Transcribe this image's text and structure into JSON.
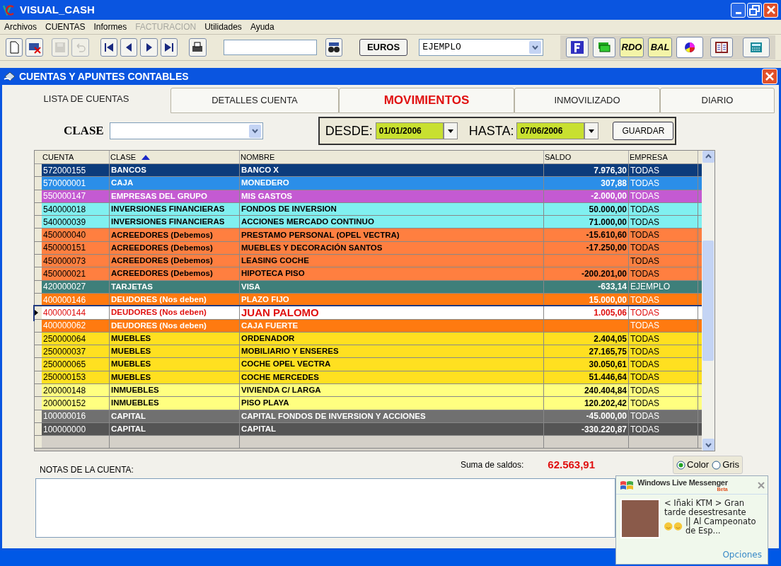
{
  "window": {
    "title": "VISUAL_CASH"
  },
  "menu": [
    {
      "label": "Archivos",
      "disabled": false
    },
    {
      "label": "CUENTAS",
      "disabled": false
    },
    {
      "label": "Informes",
      "disabled": false
    },
    {
      "label": "FACTURACION",
      "disabled": true
    },
    {
      "label": "Utilidades",
      "disabled": false
    },
    {
      "label": "Ayuda",
      "disabled": false
    }
  ],
  "toolbar": {
    "currency_button": "EUROS",
    "company_combo": "EJEMPLO",
    "report_buttons": [
      "RDO",
      "BAL"
    ]
  },
  "child_window": {
    "title": "CUENTAS Y APUNTES CONTABLES"
  },
  "tabs": [
    {
      "label": "LISTA DE CUENTAS",
      "selected": true,
      "highlight": false
    },
    {
      "label": "DETALLES CUENTA",
      "selected": false,
      "highlight": false
    },
    {
      "label": "MOVIMIENTOS",
      "selected": false,
      "highlight": true
    },
    {
      "label": "INMOVILIZADO",
      "selected": false,
      "highlight": false
    },
    {
      "label": "DIARIO",
      "selected": false,
      "highlight": false
    }
  ],
  "filter": {
    "clase_label": "CLASE",
    "desde_label": "DESDE:",
    "desde": "01/01/2006",
    "hasta_label": "HASTA:",
    "hasta": "07/06/2006",
    "save_button": "GUARDAR"
  },
  "table": {
    "columns": [
      "CUENTA",
      "CLASE",
      "NOMBRE",
      "SALDO",
      "EMPRESA"
    ],
    "rows": [
      {
        "cuenta": "572000155",
        "clase": "BANCOS",
        "nombre": "BANCO X",
        "saldo": "7.976,30",
        "empresa": "TODAS",
        "color": "#0c3c7c",
        "selected": false
      },
      {
        "cuenta": "570000001",
        "clase": "CAJA",
        "nombre": "MONEDERO",
        "saldo": "307,88",
        "empresa": "TODAS",
        "color": "#2b8ee8",
        "selected": false
      },
      {
        "cuenta": "550000147",
        "clase": "EMPRESAS DEL GRUPO",
        "nombre": "MIS GASTOS",
        "saldo": "-2.000,00",
        "empresa": "TODAS",
        "color": "#c45ad2",
        "selected": false
      },
      {
        "cuenta": "540000018",
        "clase": "INVERSIONES FINANCIERAS",
        "nombre": "FONDOS DE INVERSION",
        "saldo": "50.000,00",
        "empresa": "TODAS",
        "color": "#80f0f0",
        "selected": false
      },
      {
        "cuenta": "540000039",
        "clase": "INVERSIONES FINANCIERAS",
        "nombre": "ACCIONES MERCADO CONTINUO",
        "saldo": "71.000,00",
        "empresa": "TODAS",
        "color": "#80f0f0",
        "selected": false
      },
      {
        "cuenta": "450000040",
        "clase": "ACREEDORES (Debemos)",
        "nombre": "PRESTAMO PERSONAL (OPEL VECTRA)",
        "saldo": "-15.610,60",
        "empresa": "TODAS",
        "color": "#ff7f40",
        "selected": false
      },
      {
        "cuenta": "450000151",
        "clase": "ACREEDORES (Debemos)",
        "nombre": "MUEBLES Y DECORACIÓN SANTOS",
        "saldo": "-17.250,00",
        "empresa": "TODAS",
        "color": "#ff7f40",
        "selected": false
      },
      {
        "cuenta": "450000073",
        "clase": "ACREEDORES (Debemos)",
        "nombre": "LEASING COCHE",
        "saldo": "",
        "empresa": "TODAS",
        "color": "#ff7f40",
        "selected": false
      },
      {
        "cuenta": "450000021",
        "clase": "ACREEDORES (Debemos)",
        "nombre": "HIPOTECA PISO",
        "saldo": "-200.201,00",
        "empresa": "TODAS",
        "color": "#ff7f40",
        "selected": false
      },
      {
        "cuenta": "420000027",
        "clase": "TARJETAS",
        "nombre": "VISA",
        "saldo": "-633,14",
        "empresa": "EJEMPLO",
        "color": "#3e7f7a",
        "selected": false
      },
      {
        "cuenta": "400000146",
        "clase": "DEUDORES (Nos deben)",
        "nombre": "PLAZO FIJO",
        "saldo": "15.000,00",
        "empresa": "TODAS",
        "color": "#ff7a10",
        "selected": false
      },
      {
        "cuenta": "400000144",
        "clase": "DEUDORES (Nos deben)",
        "nombre": "JUAN PALOMO",
        "saldo": "1.005,06",
        "empresa": "TODAS",
        "color": "#ffffff",
        "selected": true
      },
      {
        "cuenta": "400000062",
        "clase": "DEUDORES (Nos deben)",
        "nombre": "CAJA FUERTE",
        "saldo": "",
        "empresa": "TODAS",
        "color": "#ff7a10",
        "selected": false
      },
      {
        "cuenta": "250000064",
        "clase": "MUEBLES",
        "nombre": "ORDENADOR",
        "saldo": "2.404,05",
        "empresa": "TODAS",
        "color": "#ffe020",
        "selected": false
      },
      {
        "cuenta": "250000037",
        "clase": "MUEBLES",
        "nombre": "MOBILIARIO Y ENSERES",
        "saldo": "27.165,75",
        "empresa": "TODAS",
        "color": "#ffe020",
        "selected": false
      },
      {
        "cuenta": "250000065",
        "clase": "MUEBLES",
        "nombre": "COCHE OPEL VECTRA",
        "saldo": "30.050,61",
        "empresa": "TODAS",
        "color": "#ffe020",
        "selected": false
      },
      {
        "cuenta": "250000153",
        "clase": "MUEBLES",
        "nombre": "COCHE MERCEDES",
        "saldo": "51.446,64",
        "empresa": "TODAS",
        "color": "#ffe020",
        "selected": false
      },
      {
        "cuenta": "200000148",
        "clase": "INMUEBLES",
        "nombre": "VIVIENDA C/ LARGA",
        "saldo": "240.404,84",
        "empresa": "TODAS",
        "color": "#ffff80",
        "selected": false
      },
      {
        "cuenta": "200000152",
        "clase": "INMUEBLES",
        "nombre": "PISO PLAYA",
        "saldo": "120.202,42",
        "empresa": "TODAS",
        "color": "#ffff80",
        "selected": false
      },
      {
        "cuenta": "100000016",
        "clase": "CAPITAL",
        "nombre": "CAPITAL FONDOS DE INVERSION Y ACCIONES",
        "saldo": "-45.000,00",
        "empresa": "TODAS",
        "color": "#707070",
        "selected": false
      },
      {
        "cuenta": "100000000",
        "clase": "CAPITAL",
        "nombre": "CAPITAL",
        "saldo": "-330.220,87",
        "empresa": "TODAS",
        "color": "#555555",
        "selected": false
      }
    ]
  },
  "notes": {
    "label": "NOTAS DE LA CUENTA:"
  },
  "totals": {
    "label": "Suma de saldos:",
    "value": "62.563,91"
  },
  "view_mode": [
    {
      "label": "Color",
      "selected": true
    },
    {
      "label": "Gris",
      "selected": false
    }
  ],
  "messenger": {
    "title": "Windows Live Messenger",
    "badge": "Beta",
    "message_start": "< Iñaki KTM > Gran tarde desestresante",
    "message_end": "|| Al Campeonato de Esp...",
    "link": "Opciones"
  }
}
